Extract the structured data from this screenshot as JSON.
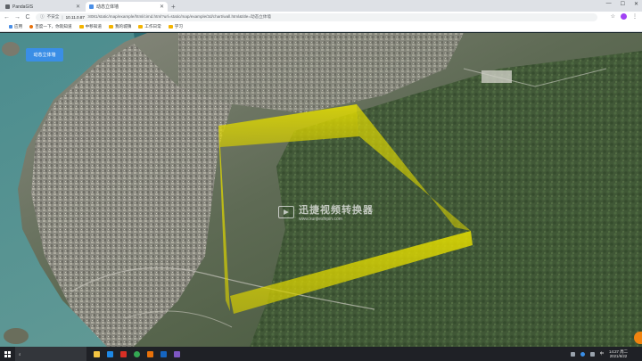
{
  "browser": {
    "tabs": [
      {
        "title": "PandaGIS",
        "active": false
      },
      {
        "title": "动态立体墙",
        "active": true
      }
    ],
    "new_tab": "+",
    "window_controls": {
      "minimize": "—",
      "maximize": "☐",
      "close": "✕"
    },
    "nav": {
      "back": "←",
      "forward": "→",
      "reload": "C"
    },
    "address": {
      "security_label": "不安全",
      "host": "10.11.0.87",
      "rest": ":8081/static/map/example/html/cimd.html?url=static/map/example/3d/chart/wall.html&title=动态立体墙"
    }
  },
  "bookmarks": [
    {
      "label": "应用",
      "icon": "apps-icon"
    },
    {
      "label": "百度一下，你就知道",
      "icon": "baidu-icon"
    },
    {
      "label": "中移知道",
      "icon": "folder-icon"
    },
    {
      "label": "我的城镇",
      "icon": "folder-icon"
    },
    {
      "label": "工作日常",
      "icon": "folder-icon"
    },
    {
      "label": "学习",
      "icon": "folder-icon"
    }
  ],
  "map": {
    "action_button": "动态立体墙",
    "watermark": {
      "title": "迅捷视频转换器",
      "url": "www.xunjieshipin.com"
    },
    "wall_color": "#e6e000"
  },
  "taskbar": {
    "search_placeholder": "",
    "apps": [
      {
        "name": "file-explorer-icon",
        "color": "#f4c542"
      },
      {
        "name": "edge-icon",
        "color": "#1e88e5"
      },
      {
        "name": "app-red-icon",
        "color": "#d93025"
      },
      {
        "name": "chrome-icon",
        "color": "#34a853"
      },
      {
        "name": "app-orange-icon",
        "color": "#e8710a"
      },
      {
        "name": "app-blue-icon",
        "color": "#1565c0"
      },
      {
        "name": "app-purple-icon",
        "color": "#7e57c2"
      }
    ],
    "clock": {
      "time": "14:27 周二",
      "date": "2021/6/22"
    },
    "tray_lang": "中"
  }
}
